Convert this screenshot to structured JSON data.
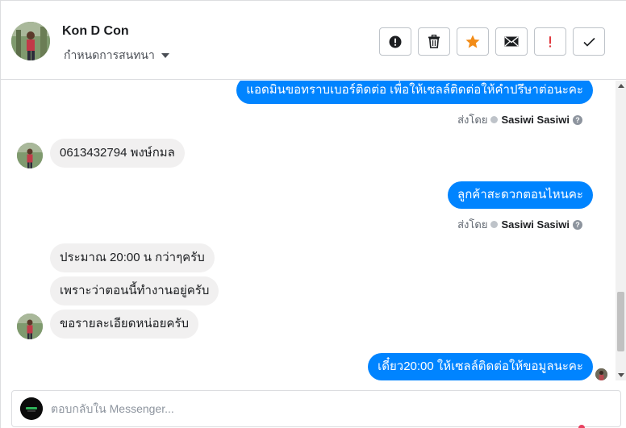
{
  "header": {
    "contact_name": "Kon D Con",
    "conversation_settings_label": "กำหนดการสนทนา",
    "toolbar": [
      {
        "name": "report-spam-button",
        "icon": "exclamation-circle-icon"
      },
      {
        "name": "delete-button",
        "icon": "trash-icon"
      },
      {
        "name": "star-button",
        "icon": "star-icon",
        "color": "#f28c18"
      },
      {
        "name": "mark-unread-button",
        "icon": "envelope-icon"
      },
      {
        "name": "flag-button",
        "icon": "exclamation-icon",
        "color": "#e0393e"
      },
      {
        "name": "mark-done-button",
        "icon": "checkmark-icon"
      }
    ]
  },
  "messages": [
    {
      "direction": "out",
      "text": "แอดมินขอทราบเบอร์ติดต่อ เพื่อให้เซลล์ติดต่อให้คำปรึษาต่อนะคะ"
    },
    {
      "type": "sent_by",
      "prefix": "ส่งโดย",
      "agent": "Sasiwi Sasiwi"
    },
    {
      "direction": "in",
      "text": "0613432794 พงษ์กมล"
    },
    {
      "direction": "out",
      "text": "ลูกค้าสะดวกตอนไหนคะ"
    },
    {
      "type": "sent_by",
      "prefix": "ส่งโดย",
      "agent": "Sasiwi Sasiwi"
    },
    {
      "direction": "in",
      "text": "ประมาณ 20:00 น กว่าๆครับ"
    },
    {
      "direction": "in",
      "text": "เพราะว่าตอนนี้ทำงานอยู่ครับ"
    },
    {
      "direction": "in",
      "text": "ขอรายละเอียดหน่อยครับ"
    },
    {
      "direction": "out",
      "text": "เดี๋ยว20:00 ให้เซลล์ติดต่อให้ขอมูลนะคะ"
    }
  ],
  "composer": {
    "placeholder": "ตอบกลับใน Messenger..."
  },
  "colors": {
    "outgoing_bubble": "#0084ff",
    "incoming_bubble": "#f1f0f0",
    "star": "#f28c18",
    "flag": "#e0393e"
  }
}
